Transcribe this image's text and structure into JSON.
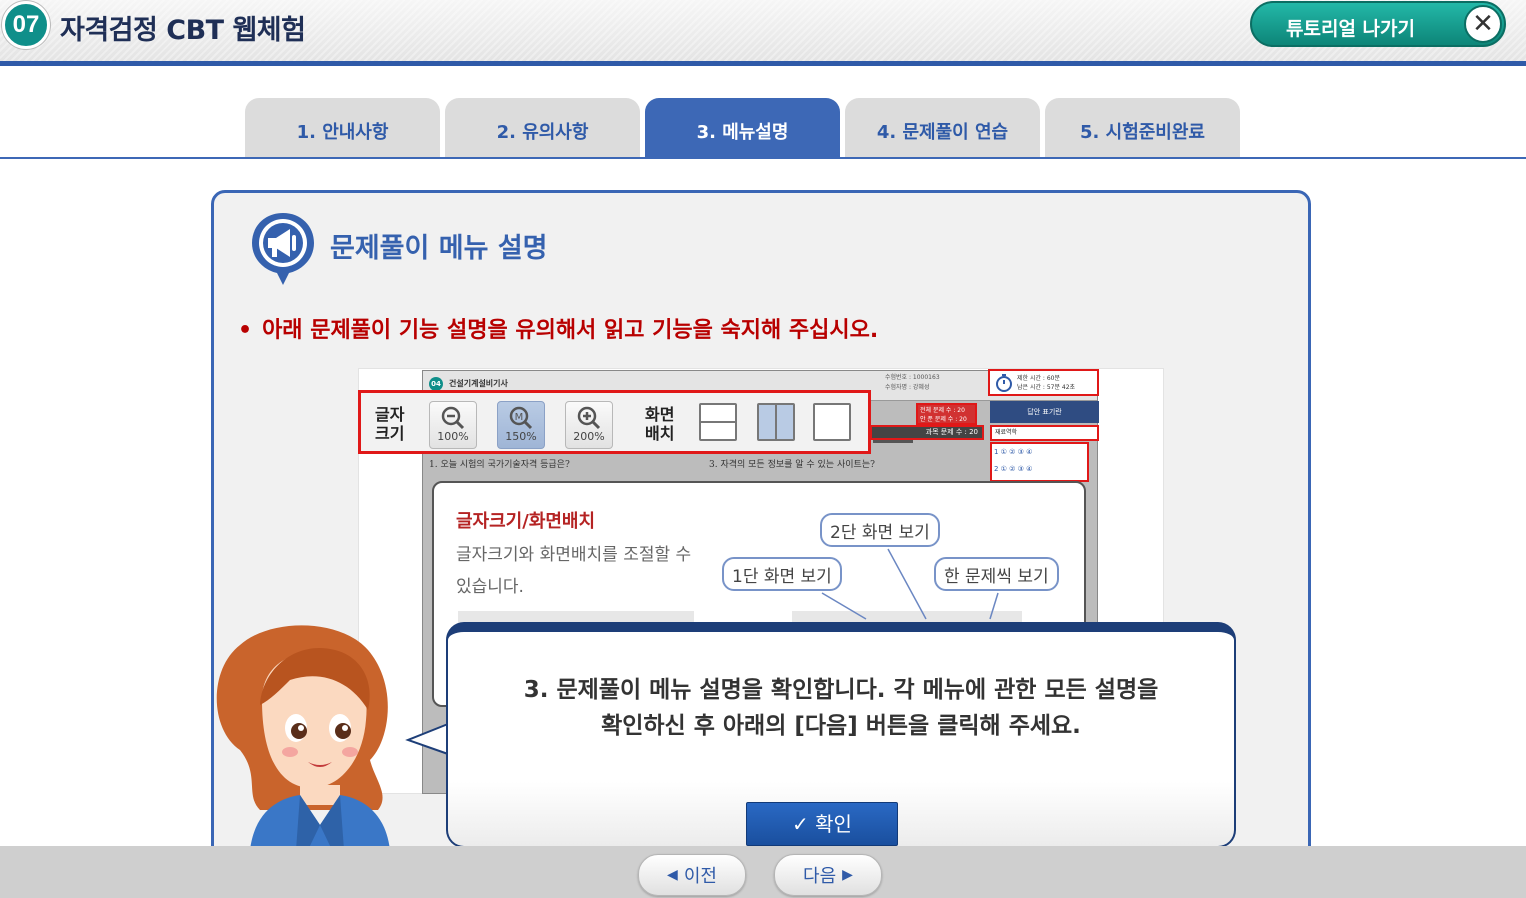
{
  "header": {
    "chapter_number": "07",
    "title": "자격검정 CBT 웹체험",
    "exit_label": "튜토리얼 나가기",
    "exit_icon": "close-icon"
  },
  "tabs": [
    {
      "label": "1. 안내사항",
      "active": false
    },
    {
      "label": "2. 유의사항",
      "active": false
    },
    {
      "label": "3. 메뉴설명",
      "active": true
    },
    {
      "label": "4. 문제풀이 연습",
      "active": false
    },
    {
      "label": "5. 시험준비완료",
      "active": false
    }
  ],
  "section": {
    "icon": "megaphone-icon",
    "title": "문제풀이 메뉴 설명",
    "instruction": "아래 문제풀이 기능 설명을 유의해서 읽고 기능을 숙지해 주십시오."
  },
  "demo": {
    "exam_badge": "04",
    "exam_name": "건설기계설비기사",
    "info_line1": "수험번호 : 1000163",
    "info_line2": "수험자명 : 강혜성",
    "font_label": "글자\n크기",
    "zoom_options": [
      "100%",
      "150%",
      "200%"
    ],
    "zoom_selected": "150%",
    "layout_label": "화면\n배치",
    "timer_line1": "제한 시간 : 60분",
    "timer_line2": "남은 시간 : 57분 42초",
    "count_line1": "전체 문제 수 : 20",
    "count_line2": "안 푼 문제 수 : 20",
    "subject_label": "과목 문제 수 : 20",
    "answer_header": "답안 표기란",
    "answer_select": "재료역학",
    "answer_rows": [
      "1  ① ② ③ ④",
      "2  ① ② ③ ④"
    ],
    "question1": "1. 오늘 시험의 국가기술자격 등급은?",
    "question3": "3. 자격의 모든 정보를 알 수 있는 사이트는?",
    "popup": {
      "title": "글자크기/화면배치",
      "description": "글자크기와 화면배치를 조절할 수 있습니다.",
      "callout_two": "2단 화면 보기",
      "callout_one": "1단 화면 보기",
      "callout_single": "한 문제씩 보기"
    }
  },
  "bubble": {
    "line1": "3. 문제풀이 메뉴 설명을 확인합니다. 각 메뉴에 관한 모든 설명을",
    "line2": "확인하신 후 아래의 [다음] 버튼을 클릭해 주세요.",
    "confirm_label": "✓ 확인"
  },
  "nav": {
    "prev_label": "이전",
    "next_label": "다음"
  },
  "colors": {
    "brand_blue": "#3d68b6",
    "teal": "#0f8f8a",
    "alert_red": "#b80000"
  }
}
